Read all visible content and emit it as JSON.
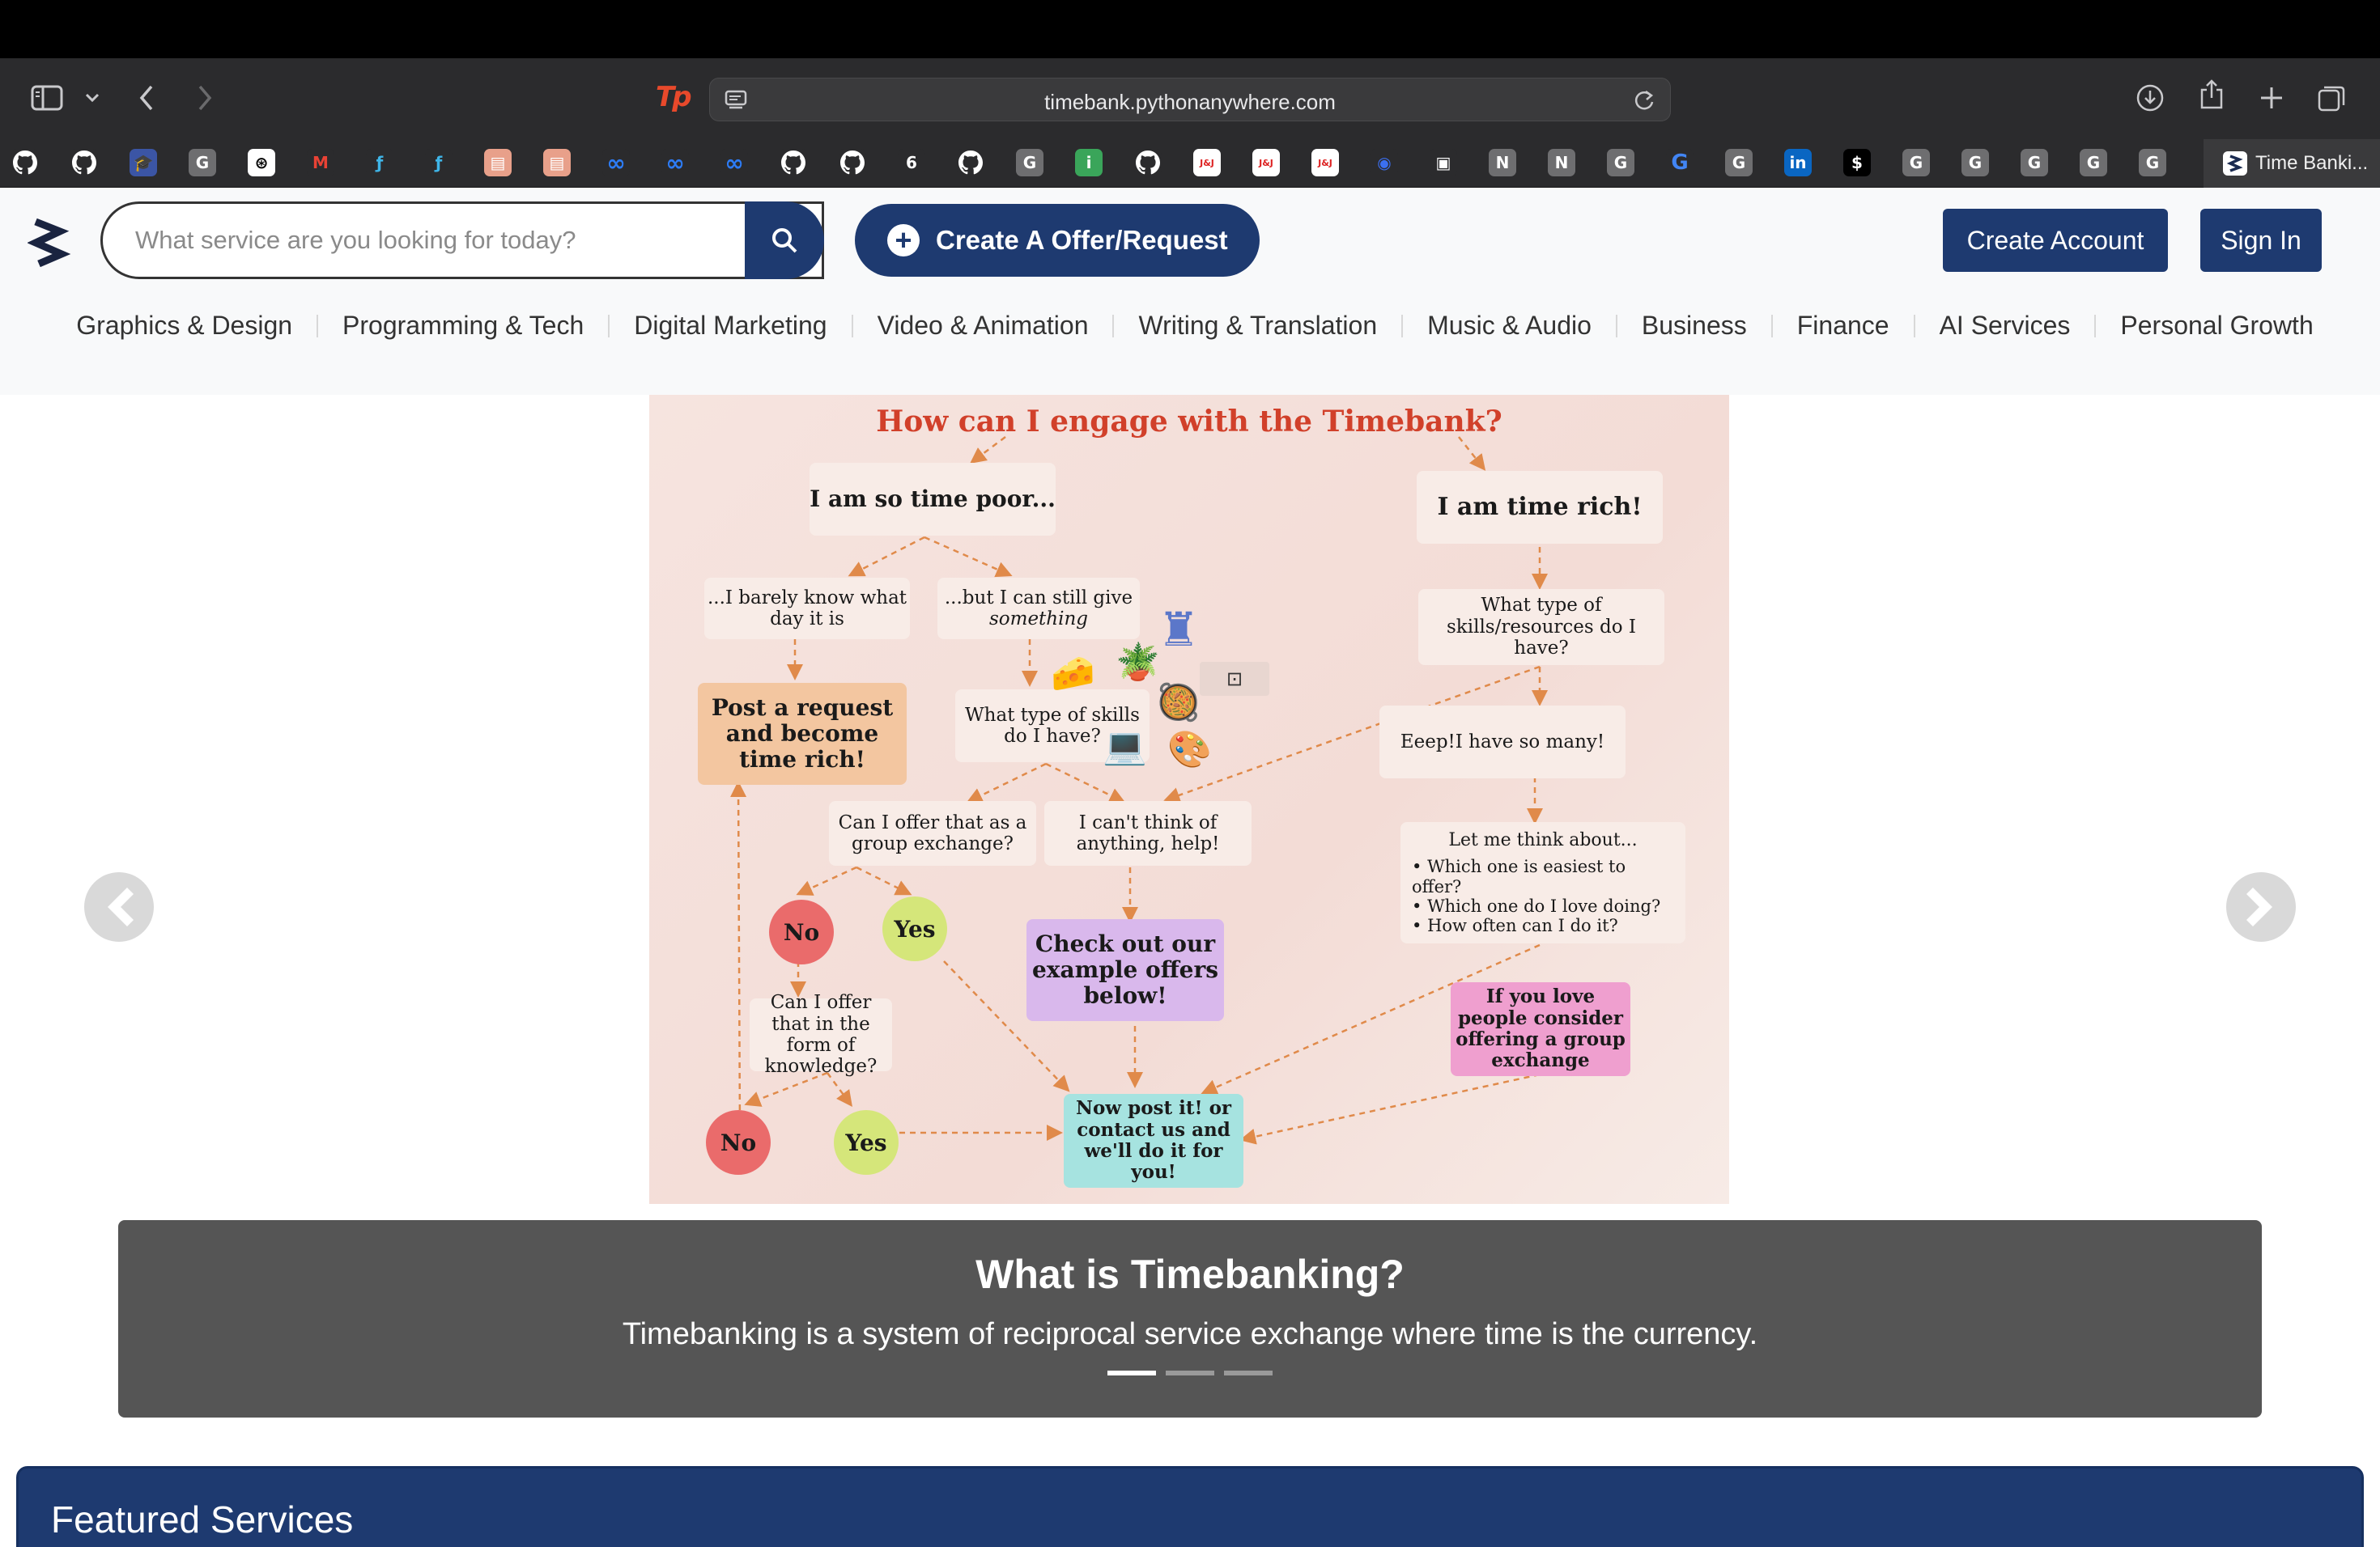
{
  "browser": {
    "url": "timebank.pythonanywhere.com",
    "active_tab_title": "Time Banki..."
  },
  "bookmarks": [
    {
      "icon": "github-icon",
      "glyph": "",
      "bg": "#2b2b2d"
    },
    {
      "icon": "github-icon",
      "glyph": "",
      "bg": "#2b2b2d"
    },
    {
      "icon": "school-icon",
      "glyph": "🎓",
      "bg": "#3b55a5"
    },
    {
      "icon": "generic-g-icon",
      "glyph": "G",
      "bg": "#6e6e70"
    },
    {
      "icon": "chatgpt-icon",
      "glyph": "⊛",
      "bg": "#ffffff"
    },
    {
      "icon": "gmail-icon",
      "glyph": "M",
      "bg": "#2b2b2d"
    },
    {
      "icon": "tf-icon",
      "glyph": "ƒ",
      "bg": "#2b2b2d"
    },
    {
      "icon": "tf-icon",
      "glyph": "ƒ",
      "bg": "#2b2b2d"
    },
    {
      "icon": "stack-icon",
      "glyph": "▤",
      "bg": "#e8a08a"
    },
    {
      "icon": "stack-icon",
      "glyph": "▤",
      "bg": "#e8a08a"
    },
    {
      "icon": "meta-icon",
      "glyph": "∞",
      "bg": "#2b2b2d"
    },
    {
      "icon": "meta-icon",
      "glyph": "∞",
      "bg": "#2b2b2d"
    },
    {
      "icon": "meta-icon",
      "glyph": "∞",
      "bg": "#2b2b2d"
    },
    {
      "icon": "github-icon",
      "glyph": "",
      "bg": "#2b2b2d"
    },
    {
      "icon": "github-icon",
      "glyph": "",
      "bg": "#2b2b2d"
    },
    {
      "icon": "six-icon",
      "glyph": "6",
      "bg": "#2b2b2d"
    },
    {
      "icon": "github-icon",
      "glyph": "",
      "bg": "#2b2b2d"
    },
    {
      "icon": "generic-g-icon",
      "glyph": "G",
      "bg": "#6e6e70"
    },
    {
      "icon": "info-icon",
      "glyph": "i",
      "bg": "#3aa55a"
    },
    {
      "icon": "github-icon",
      "glyph": "",
      "bg": "#2b2b2d"
    },
    {
      "icon": "jj-icon",
      "glyph": "J&J",
      "bg": "#ffffff"
    },
    {
      "icon": "jj-icon",
      "glyph": "J&J",
      "bg": "#ffffff"
    },
    {
      "icon": "jj-icon",
      "glyph": "J&J",
      "bg": "#ffffff"
    },
    {
      "icon": "circle-icon",
      "glyph": "◉",
      "bg": "#2b2b2d"
    },
    {
      "icon": "box-icon",
      "glyph": "▣",
      "bg": "#2b2b2d"
    },
    {
      "icon": "notion-icon",
      "glyph": "N",
      "bg": "#6e6e70"
    },
    {
      "icon": "notion-icon",
      "glyph": "N",
      "bg": "#6e6e70"
    },
    {
      "icon": "generic-g-icon",
      "glyph": "G",
      "bg": "#6e6e70"
    },
    {
      "icon": "google-icon",
      "glyph": "G",
      "bg": "#2b2b2d"
    },
    {
      "icon": "generic-g-icon",
      "glyph": "G",
      "bg": "#6e6e70"
    },
    {
      "icon": "linkedin-icon",
      "glyph": "in",
      "bg": "#0a66c2"
    },
    {
      "icon": "dollar-icon",
      "glyph": "$",
      "bg": "#000000"
    },
    {
      "icon": "generic-g-icon",
      "glyph": "G",
      "bg": "#6e6e70"
    },
    {
      "icon": "generic-g-icon",
      "glyph": "G",
      "bg": "#6e6e70"
    },
    {
      "icon": "generic-g-icon",
      "glyph": "G",
      "bg": "#6e6e70"
    },
    {
      "icon": "generic-g-icon",
      "glyph": "G",
      "bg": "#6e6e70"
    },
    {
      "icon": "generic-g-icon",
      "glyph": "G",
      "bg": "#6e6e70"
    }
  ],
  "header": {
    "search_placeholder": "What service are you looking for today?",
    "create_offer_label": "Create A Offer/Request",
    "create_account_label": "Create Account",
    "sign_in_label": "Sign In"
  },
  "categories": [
    "Graphics & Design",
    "Programming & Tech",
    "Digital Marketing",
    "Video & Animation",
    "Writing & Translation",
    "Music & Audio",
    "Business",
    "Finance",
    "AI Services",
    "Personal Growth"
  ],
  "slide": {
    "title": "How can I engage with the Timebank?",
    "time_poor": "I am so time poor...",
    "time_rich": "I am time rich!",
    "barely_know": "...I barely know what day it is",
    "can_still_give": "...but I can still give",
    "can_still_give_em": "something",
    "post_request": "Post a request and become time rich!",
    "what_skills": "What type of skills do I have?",
    "what_skills_resources": "What type of skills/resources do I have?",
    "eeep": "Eeep!I have so many!",
    "group_exchange_q": "Can I offer that as a group exchange?",
    "cant_think": "I can't think of anything, help!",
    "let_me_think": "Let me think about...",
    "think_points": [
      "Which one is easiest to offer?",
      "Which one do I love doing?",
      "How often can I do it?"
    ],
    "no": "No",
    "yes": "Yes",
    "check_examples": "Check out our example offers below!",
    "knowledge_q": "Can I offer that in the form of knowledge?",
    "love_people": "If you love people consider offering a group exchange",
    "post_it": "Now post it! or contact us and we'll do it for you!"
  },
  "caption": {
    "title": "What is Timebanking?",
    "text": "Timebanking is a system of reciprocal service exchange where time is the currency."
  },
  "featured": {
    "title": "Featured Services"
  },
  "colors": {
    "primary": "#1e3a70",
    "caption_bg": "#555555",
    "slide_title": "#d1402a",
    "no_circle": "#ea6b6b",
    "yes_circle": "#d5e67a",
    "post_request_box": "#f3c6a0",
    "check_examples_box": "#d9b8ec",
    "love_people_box": "#ef9fcf",
    "post_it_box": "#a6e3e0"
  }
}
